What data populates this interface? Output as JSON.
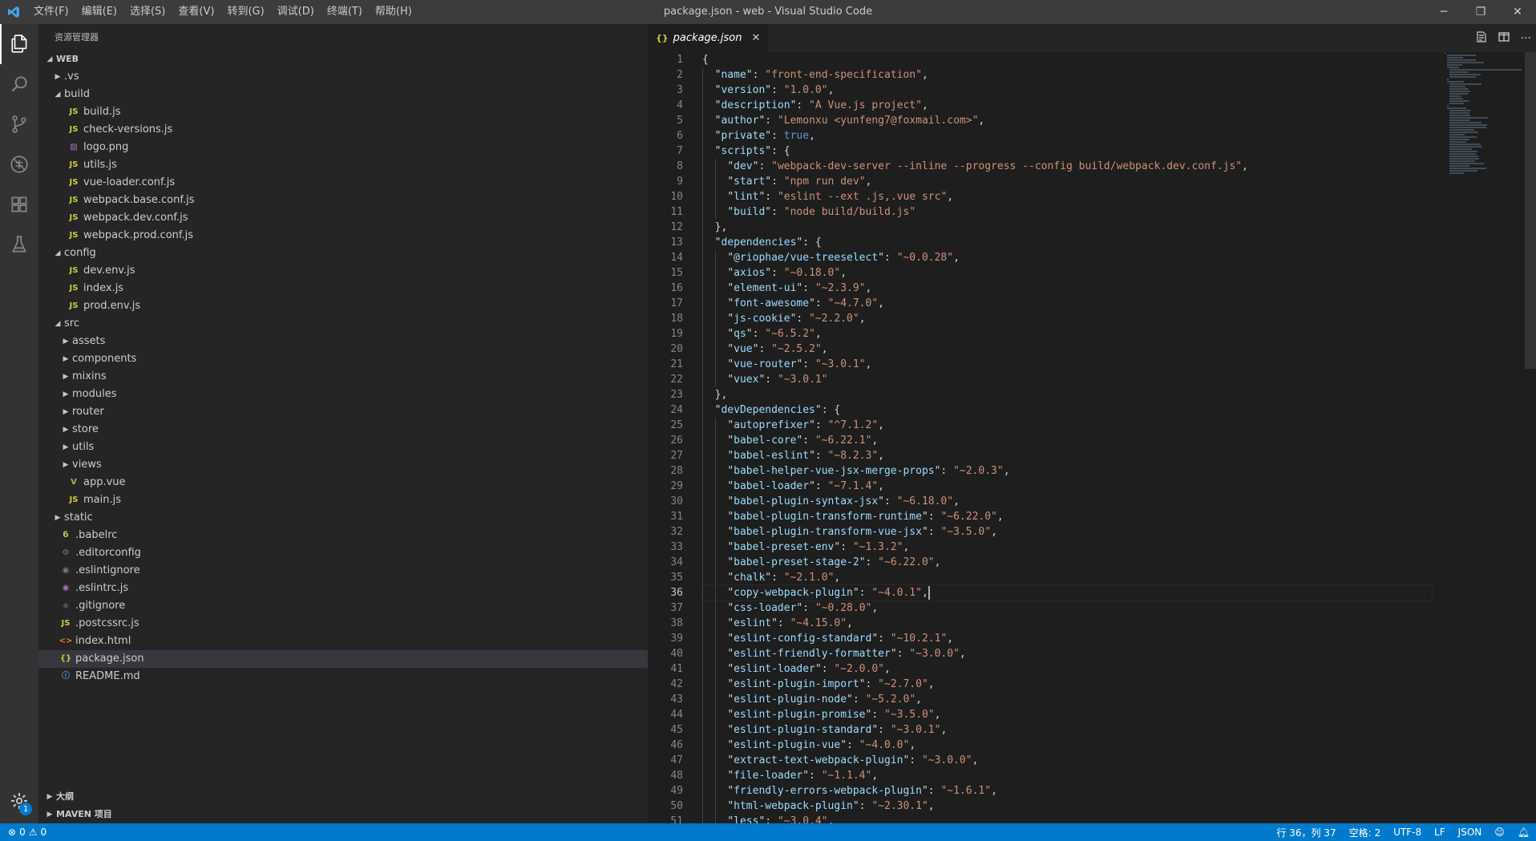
{
  "window": {
    "title": "package.json - web - Visual Studio Code",
    "menu": [
      "文件(F)",
      "编辑(E)",
      "选择(S)",
      "查看(V)",
      "转到(G)",
      "调试(D)",
      "终端(T)",
      "帮助(H)"
    ],
    "controls": {
      "minimize": "─",
      "restore": "❐",
      "close": "✕"
    }
  },
  "activity_bar": {
    "icons": [
      "files-icon",
      "search-icon",
      "source-control-icon",
      "debug-icon",
      "extensions-icon",
      "test-icon"
    ],
    "settings_badge": "1"
  },
  "sidebar": {
    "title": "资源管理器",
    "root": "WEB",
    "tree": [
      {
        "label": ".vs",
        "depth": 1,
        "type": "folder",
        "expanded": false
      },
      {
        "label": "build",
        "depth": 1,
        "type": "folder",
        "expanded": true
      },
      {
        "label": "build.js",
        "depth": 2,
        "type": "js"
      },
      {
        "label": "check-versions.js",
        "depth": 2,
        "type": "js"
      },
      {
        "label": "logo.png",
        "depth": 2,
        "type": "img"
      },
      {
        "label": "utils.js",
        "depth": 2,
        "type": "js"
      },
      {
        "label": "vue-loader.conf.js",
        "depth": 2,
        "type": "js"
      },
      {
        "label": "webpack.base.conf.js",
        "depth": 2,
        "type": "js"
      },
      {
        "label": "webpack.dev.conf.js",
        "depth": 2,
        "type": "js"
      },
      {
        "label": "webpack.prod.conf.js",
        "depth": 2,
        "type": "js"
      },
      {
        "label": "config",
        "depth": 1,
        "type": "folder",
        "expanded": true
      },
      {
        "label": "dev.env.js",
        "depth": 2,
        "type": "js"
      },
      {
        "label": "index.js",
        "depth": 2,
        "type": "js"
      },
      {
        "label": "prod.env.js",
        "depth": 2,
        "type": "js"
      },
      {
        "label": "src",
        "depth": 1,
        "type": "folder",
        "expanded": true
      },
      {
        "label": "assets",
        "depth": 2,
        "type": "folder",
        "expanded": false
      },
      {
        "label": "components",
        "depth": 2,
        "type": "folder",
        "expanded": false
      },
      {
        "label": "mixins",
        "depth": 2,
        "type": "folder",
        "expanded": false
      },
      {
        "label": "modules",
        "depth": 2,
        "type": "folder",
        "expanded": false
      },
      {
        "label": "router",
        "depth": 2,
        "type": "folder",
        "expanded": false
      },
      {
        "label": "store",
        "depth": 2,
        "type": "folder",
        "expanded": false
      },
      {
        "label": "utils",
        "depth": 2,
        "type": "folder",
        "expanded": false
      },
      {
        "label": "views",
        "depth": 2,
        "type": "folder",
        "expanded": false
      },
      {
        "label": "app.vue",
        "depth": 2,
        "type": "vue"
      },
      {
        "label": "main.js",
        "depth": 2,
        "type": "js"
      },
      {
        "label": "static",
        "depth": 1,
        "type": "folder",
        "expanded": false
      },
      {
        "label": ".babelrc",
        "depth": 1,
        "type": "babel"
      },
      {
        "label": ".editorconfig",
        "depth": 1,
        "type": "gear"
      },
      {
        "label": ".eslintignore",
        "depth": 1,
        "type": "eslintignore"
      },
      {
        "label": ".eslintrc.js",
        "depth": 1,
        "type": "eslint"
      },
      {
        "label": ".gitignore",
        "depth": 1,
        "type": "git"
      },
      {
        "label": ".postcssrc.js",
        "depth": 1,
        "type": "js"
      },
      {
        "label": "index.html",
        "depth": 1,
        "type": "html"
      },
      {
        "label": "package.json",
        "depth": 1,
        "type": "json",
        "selected": true
      },
      {
        "label": "README.md",
        "depth": 1,
        "type": "info"
      }
    ],
    "bottom_sections": [
      "大纲",
      "MAVEN 项目"
    ]
  },
  "editor": {
    "tab": {
      "label": "package.json",
      "icon": "{}"
    },
    "current_line": 36,
    "lines": [
      {
        "indent": 0,
        "text": "{"
      },
      {
        "indent": 1,
        "key": "name",
        "value": "front-end-specification",
        "comma": true
      },
      {
        "indent": 1,
        "key": "version",
        "value": "1.0.0",
        "comma": true
      },
      {
        "indent": 1,
        "key": "description",
        "value": "A Vue.js project",
        "comma": true
      },
      {
        "indent": 1,
        "key": "author",
        "value": "Lemonxu <yunfeng7@foxmail.com>",
        "comma": true
      },
      {
        "indent": 1,
        "key": "private",
        "bool": "true",
        "comma": true
      },
      {
        "indent": 1,
        "key": "scripts",
        "open": "{"
      },
      {
        "indent": 2,
        "key": "dev",
        "value": "webpack-dev-server --inline --progress --config build/webpack.dev.conf.js",
        "comma": true
      },
      {
        "indent": 2,
        "key": "start",
        "value": "npm run dev",
        "comma": true
      },
      {
        "indent": 2,
        "key": "lint",
        "value": "eslint --ext .js,.vue src",
        "comma": true
      },
      {
        "indent": 2,
        "key": "build",
        "value": "node build/build.js"
      },
      {
        "indent": 1,
        "text": "},"
      },
      {
        "indent": 1,
        "key": "dependencies",
        "open": "{"
      },
      {
        "indent": 2,
        "key": "@riophae/vue-treeselect",
        "value": "~0.0.28",
        "comma": true
      },
      {
        "indent": 2,
        "key": "axios",
        "value": "~0.18.0",
        "comma": true
      },
      {
        "indent": 2,
        "key": "element-ui",
        "value": "~2.3.9",
        "comma": true
      },
      {
        "indent": 2,
        "key": "font-awesome",
        "value": "~4.7.0",
        "comma": true
      },
      {
        "indent": 2,
        "key": "js-cookie",
        "value": "~2.2.0",
        "comma": true
      },
      {
        "indent": 2,
        "key": "qs",
        "value": "~6.5.2",
        "comma": true
      },
      {
        "indent": 2,
        "key": "vue",
        "value": "~2.5.2",
        "comma": true
      },
      {
        "indent": 2,
        "key": "vue-router",
        "value": "~3.0.1",
        "comma": true
      },
      {
        "indent": 2,
        "key": "vuex",
        "value": "~3.0.1"
      },
      {
        "indent": 1,
        "text": "},"
      },
      {
        "indent": 1,
        "key": "devDependencies",
        "open": "{"
      },
      {
        "indent": 2,
        "key": "autoprefixer",
        "value": "^7.1.2",
        "comma": true
      },
      {
        "indent": 2,
        "key": "babel-core",
        "value": "~6.22.1",
        "comma": true
      },
      {
        "indent": 2,
        "key": "babel-eslint",
        "value": "~8.2.3",
        "comma": true
      },
      {
        "indent": 2,
        "key": "babel-helper-vue-jsx-merge-props",
        "value": "~2.0.3",
        "comma": true
      },
      {
        "indent": 2,
        "key": "babel-loader",
        "value": "~7.1.4",
        "comma": true
      },
      {
        "indent": 2,
        "key": "babel-plugin-syntax-jsx",
        "value": "~6.18.0",
        "comma": true
      },
      {
        "indent": 2,
        "key": "babel-plugin-transform-runtime",
        "value": "~6.22.0",
        "comma": true
      },
      {
        "indent": 2,
        "key": "babel-plugin-transform-vue-jsx",
        "value": "~3.5.0",
        "comma": true
      },
      {
        "indent": 2,
        "key": "babel-preset-env",
        "value": "~1.3.2",
        "comma": true
      },
      {
        "indent": 2,
        "key": "babel-preset-stage-2",
        "value": "~6.22.0",
        "comma": true
      },
      {
        "indent": 2,
        "key": "chalk",
        "value": "~2.1.0",
        "comma": true
      },
      {
        "indent": 2,
        "key": "copy-webpack-plugin",
        "value": "~4.0.1",
        "comma": true,
        "cursor": true
      },
      {
        "indent": 2,
        "key": "css-loader",
        "value": "~0.28.0",
        "comma": true
      },
      {
        "indent": 2,
        "key": "eslint",
        "value": "~4.15.0",
        "comma": true
      },
      {
        "indent": 2,
        "key": "eslint-config-standard",
        "value": "~10.2.1",
        "comma": true
      },
      {
        "indent": 2,
        "key": "eslint-friendly-formatter",
        "value": "~3.0.0",
        "comma": true
      },
      {
        "indent": 2,
        "key": "eslint-loader",
        "value": "~2.0.0",
        "comma": true
      },
      {
        "indent": 2,
        "key": "eslint-plugin-import",
        "value": "~2.7.0",
        "comma": true
      },
      {
        "indent": 2,
        "key": "eslint-plugin-node",
        "value": "~5.2.0",
        "comma": true
      },
      {
        "indent": 2,
        "key": "eslint-plugin-promise",
        "value": "~3.5.0",
        "comma": true
      },
      {
        "indent": 2,
        "key": "eslint-plugin-standard",
        "value": "~3.0.1",
        "comma": true
      },
      {
        "indent": 2,
        "key": "eslint-plugin-vue",
        "value": "~4.0.0",
        "comma": true
      },
      {
        "indent": 2,
        "key": "extract-text-webpack-plugin",
        "value": "~3.0.0",
        "comma": true
      },
      {
        "indent": 2,
        "key": "file-loader",
        "value": "~1.1.4",
        "comma": true
      },
      {
        "indent": 2,
        "key": "friendly-errors-webpack-plugin",
        "value": "~1.6.1",
        "comma": true
      },
      {
        "indent": 2,
        "key": "html-webpack-plugin",
        "value": "~2.30.1",
        "comma": true
      },
      {
        "indent": 2,
        "key": "less",
        "value": "~3.0.4",
        "comma": true
      }
    ]
  },
  "status_bar": {
    "errors": "0",
    "warnings": "0",
    "position": "行 36，列 37",
    "spaces": "空格: 2",
    "encoding": "UTF-8",
    "eol": "LF",
    "language": "JSON"
  },
  "colors": {
    "accent": "#007acc",
    "key": "#9cdcfe",
    "string": "#ce9178",
    "boolean": "#569cd6"
  }
}
